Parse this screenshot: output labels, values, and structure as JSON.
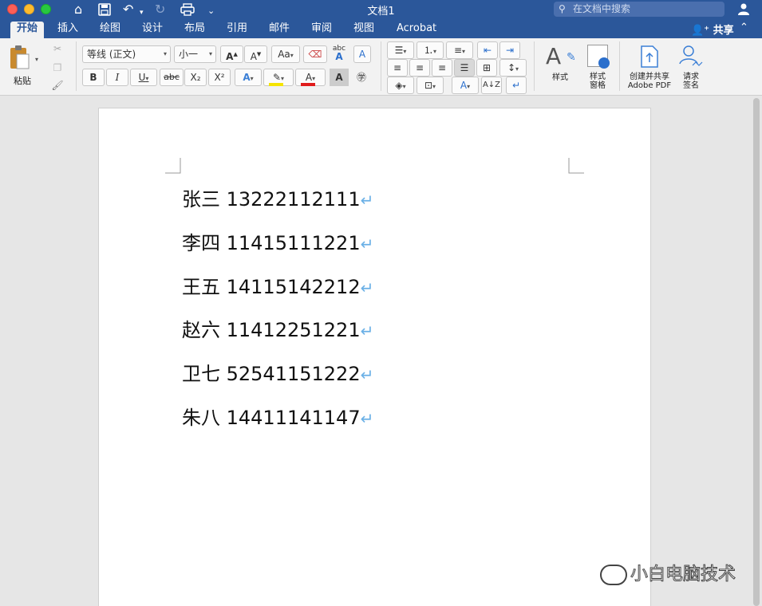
{
  "window": {
    "title": "文档1",
    "search_placeholder": "在文档中搜索"
  },
  "tabs": [
    "开始",
    "插入",
    "绘图",
    "设计",
    "布局",
    "引用",
    "邮件",
    "审阅",
    "视图",
    "Acrobat"
  ],
  "share_label": "共享",
  "ribbon": {
    "paste_label": "粘贴",
    "font_name": "等线 (正文)",
    "font_size": "小一",
    "bold": "B",
    "italic": "I",
    "underline": "U",
    "strikethrough": "abc",
    "subscript": "X₂",
    "superscript": "X²",
    "styles_label": "样式",
    "styles_pane_label_line1": "样式",
    "styles_pane_label_line2": "窗格",
    "create_pdf_line1": "创建并共享",
    "create_pdf_line2": "Adobe PDF",
    "request_sign_line1": "请求",
    "request_sign_line2": "签名",
    "highlight_color": "#f5e400",
    "font_color": "#e01b1b"
  },
  "document": {
    "lines": [
      "张三 13222112111",
      "李四 11415111221",
      "王五 14115142212",
      "赵六 11412251221",
      "卫七 52541151222",
      "朱八 14411141147"
    ],
    "paragraph_mark": "↵"
  },
  "watermark": "小白电脑技术",
  "colors": {
    "accent": "#2b579a"
  }
}
